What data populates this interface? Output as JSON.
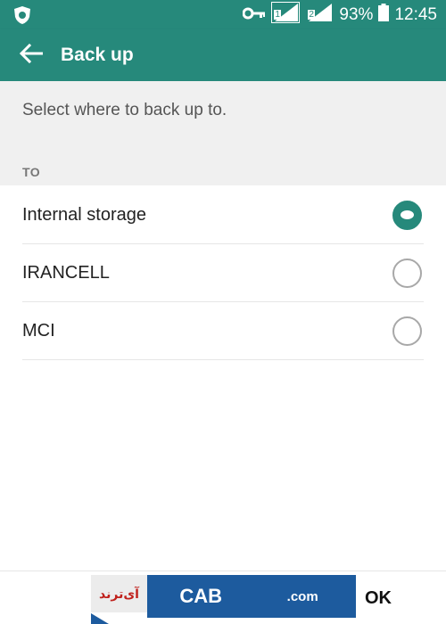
{
  "status_bar": {
    "battery": "93%",
    "time": "12:45",
    "sim1": "1",
    "sim2": "2"
  },
  "app_bar": {
    "title": "Back up"
  },
  "description": "Select where to back up to.",
  "section_header": "TO",
  "options": [
    {
      "label": "Internal storage",
      "selected": true
    },
    {
      "label": "IRANCELL",
      "selected": false
    },
    {
      "label": "MCI",
      "selected": false
    }
  ],
  "watermark": {
    "persian_text": "آی‌ترند",
    "brand_text": "CAB",
    "domain": ".com"
  },
  "buttons": {
    "ok": "OK"
  },
  "colors": {
    "accent": "#26897b",
    "watermark_blue": "#1d5b9e",
    "watermark_red": "#c0211c"
  }
}
